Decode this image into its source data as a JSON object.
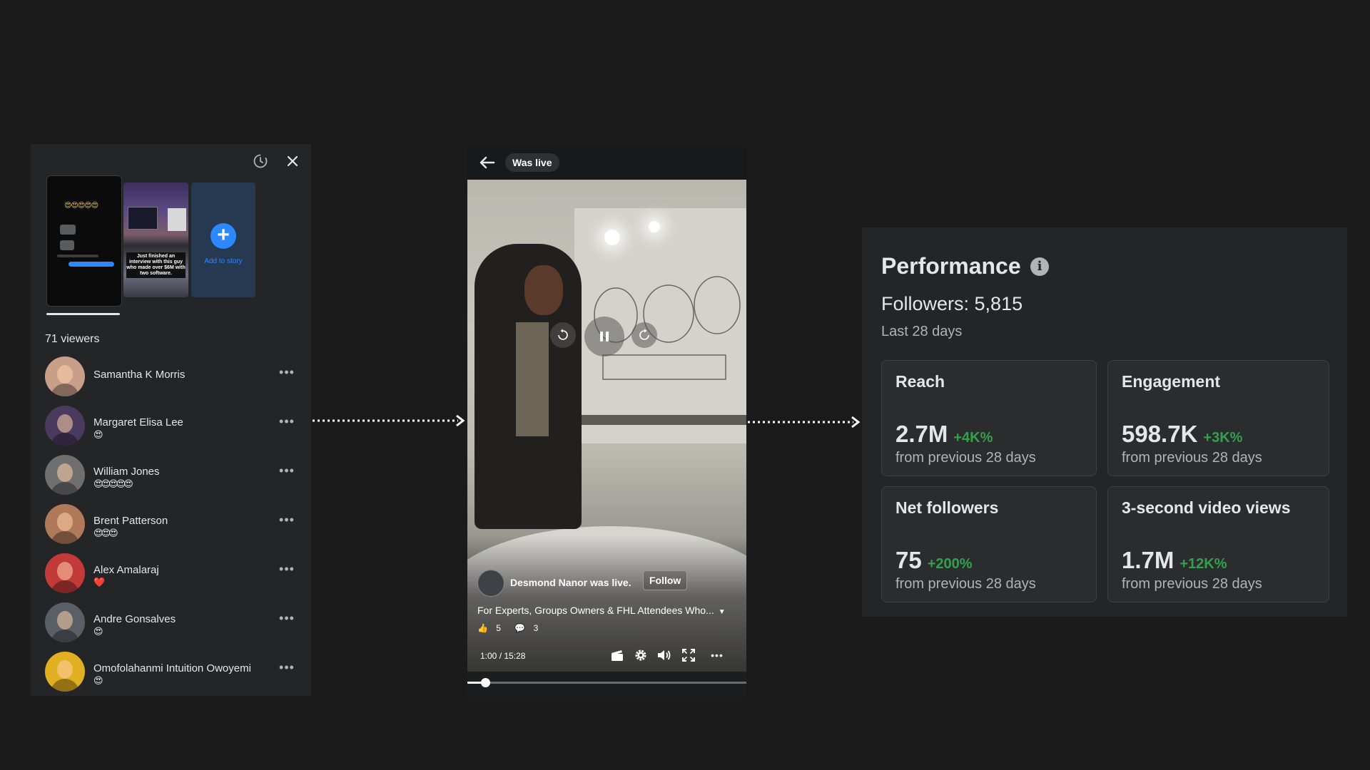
{
  "viewers_panel": {
    "add_story_label": "Add to story",
    "thumbnail_caption": "Just finished an interview with this guy who made over $6M with two software.",
    "viewers_count": "71 viewers",
    "viewers": [
      {
        "name": "Samantha K Morris",
        "reactions": "",
        "avatar_color": "#c8a08a"
      },
      {
        "name": "Margaret Elisa Lee",
        "reactions": "😍",
        "avatar_color": "#4a3a5e"
      },
      {
        "name": "William Jones",
        "reactions": "😍😍😍😍😍",
        "avatar_color": "#6f6f6f"
      },
      {
        "name": "Brent Patterson",
        "reactions": "😍😍😍",
        "avatar_color": "#b07a5a"
      },
      {
        "name": "Alex Amalaraj",
        "reactions": "❤️",
        "avatar_color": "#c23a3a"
      },
      {
        "name": "Andre  Gonsalves",
        "reactions": "😍",
        "avatar_color": "#5a5f66"
      },
      {
        "name": "Omofolahanmi Intuition Owoyemi",
        "reactions": "😍",
        "avatar_color": "#e0b020"
      }
    ],
    "more_label": "•••"
  },
  "video_panel": {
    "header_label": "Was live",
    "streamer_text": "Desmond Nanor was live.",
    "follow_label": "Follow",
    "title": "For Experts, Groups Owners & FHL Attendees Who...",
    "likes": "5",
    "comments": "3",
    "time": "1:00  /  15:28",
    "progress": 0.0647
  },
  "performance": {
    "title": "Performance",
    "info_glyph": "i",
    "followers": "Followers: 5,815",
    "period": "Last 28 days",
    "metrics": [
      {
        "label": "Reach",
        "value": "2.7M",
        "change": "+4K%",
        "sub": "from previous 28 days"
      },
      {
        "label": "Engagement",
        "value": "598.7K",
        "change": "+3K%",
        "sub": "from previous 28 days"
      },
      {
        "label": "Net followers",
        "value": "75",
        "change": "+200%",
        "sub": "from previous 28 days"
      },
      {
        "label": "3-second video views",
        "value": "1.7M",
        "change": "+12K%",
        "sub": "from previous 28 days"
      }
    ],
    "positive_color": "#31a24c"
  }
}
